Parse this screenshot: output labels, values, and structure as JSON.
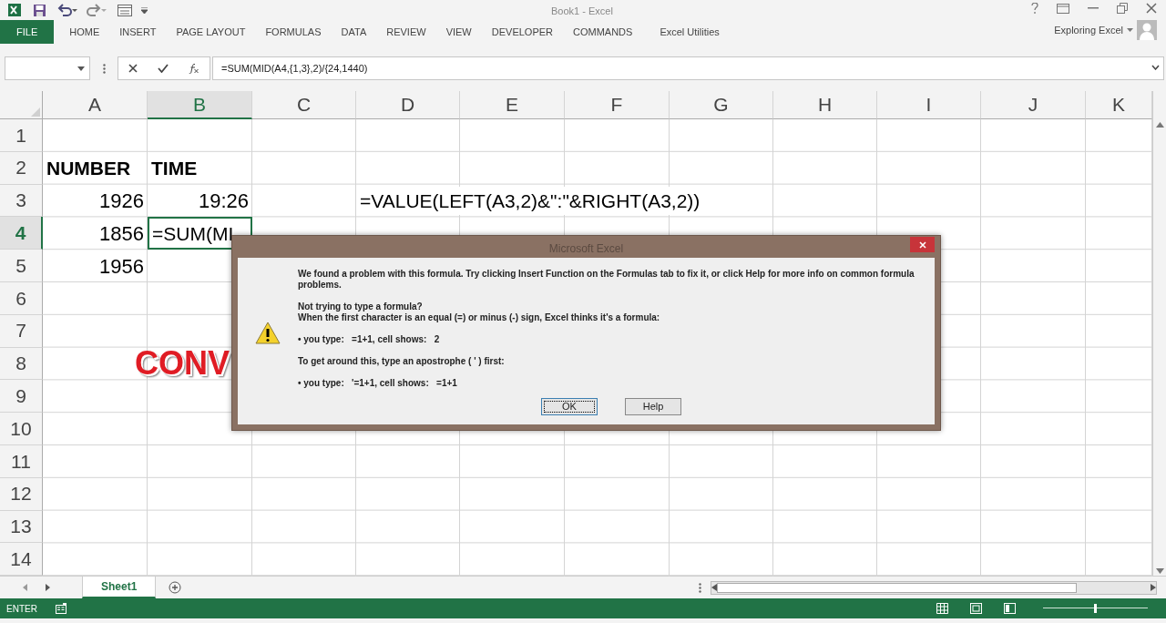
{
  "title_bar": {
    "title": "Book1 - Excel"
  },
  "ribbon_tabs": [
    {
      "label": "FILE",
      "kind": "file",
      "selected": false
    },
    {
      "label": "HOME",
      "kind": "tab",
      "selected": false
    },
    {
      "label": "INSERT",
      "kind": "tab",
      "selected": false
    },
    {
      "label": "PAGE LAYOUT",
      "kind": "tab",
      "selected": false
    },
    {
      "label": "FORMULAS",
      "kind": "tab",
      "selected": false
    },
    {
      "label": "DATA",
      "kind": "tab",
      "selected": false
    },
    {
      "label": "REVIEW",
      "kind": "tab",
      "selected": false
    },
    {
      "label": "VIEW",
      "kind": "tab",
      "selected": false
    },
    {
      "label": "DEVELOPER",
      "kind": "tab",
      "selected": false
    },
    {
      "label": "COMMANDS",
      "kind": "tab",
      "selected": false
    },
    {
      "label": "Excel Utilities",
      "kind": "tab",
      "selected": false
    }
  ],
  "account": {
    "name": "Exploring Excel"
  },
  "formula_bar": {
    "formula": "=SUM(MID(A4,{1,3},2)/{24,1440)"
  },
  "columns": [
    {
      "label": "A",
      "selected": false
    },
    {
      "label": "B",
      "selected": true
    },
    {
      "label": "C",
      "selected": false
    },
    {
      "label": "D",
      "selected": false
    },
    {
      "label": "E",
      "selected": false
    },
    {
      "label": "F",
      "selected": false
    },
    {
      "label": "G",
      "selected": false
    },
    {
      "label": "H",
      "selected": false
    },
    {
      "label": "I",
      "selected": false
    },
    {
      "label": "J",
      "selected": false
    },
    {
      "label": "K",
      "selected": false
    }
  ],
  "rows": [
    {
      "header": "1",
      "selected": false
    },
    {
      "header": "2",
      "selected": false,
      "cells": {
        "A": {
          "text": "NUMBER",
          "kind": "heading"
        },
        "B": {
          "text": "TIME",
          "kind": "heading"
        }
      }
    },
    {
      "header": "3",
      "selected": false,
      "cells": {
        "A": {
          "text": "1926",
          "kind": "number"
        },
        "B": {
          "text": "19:26",
          "kind": "number"
        },
        "D": {
          "text": "=VALUE(LEFT(A3,2)&\":\"&RIGHT(A3,2))",
          "kind": "text"
        }
      }
    },
    {
      "header": "4",
      "selected": true,
      "cells": {
        "A": {
          "text": "1856",
          "kind": "number"
        },
        "B": {
          "text": "=SUM(MI",
          "kind": "editing"
        }
      }
    },
    {
      "header": "5",
      "selected": false,
      "cells": {
        "A": {
          "text": "1956",
          "kind": "number"
        }
      }
    },
    {
      "header": "6",
      "selected": false
    },
    {
      "header": "7",
      "selected": false
    },
    {
      "header": "8",
      "selected": false,
      "cells": {
        "B": {
          "text": "CONV",
          "kind": "wordart"
        }
      }
    },
    {
      "header": "9",
      "selected": false
    },
    {
      "header": "10",
      "selected": false
    },
    {
      "header": "11",
      "selected": false
    },
    {
      "header": "12",
      "selected": false
    },
    {
      "header": "13",
      "selected": false
    },
    {
      "header": "14",
      "selected": false
    }
  ],
  "dialog": {
    "title": "Microsoft Excel",
    "paragraphs": [
      [
        "We found a problem with this formula. Try clicking Insert Function on the Formulas tab to fix it, or click Help for more info on common formula problems."
      ],
      [
        "Not trying to type a formula?",
        "When the first character is an equal (=) or minus (-) sign, Excel thinks it's a formula:"
      ],
      [
        "• you type:   =1+1, cell shows:   2"
      ],
      [
        "To get around this, type an apostrophe ( ' ) first:"
      ],
      [
        "• you type:   '=1+1, cell shows:   =1+1"
      ]
    ],
    "buttons": [
      {
        "label": "OK",
        "selected": true
      },
      {
        "label": "Help",
        "selected": false
      }
    ]
  },
  "sheet_tabs": [
    {
      "label": "Sheet1",
      "selected": true
    }
  ],
  "status_bar": {
    "mode": "ENTER",
    "zoom": {
      "level": 0.5
    }
  }
}
